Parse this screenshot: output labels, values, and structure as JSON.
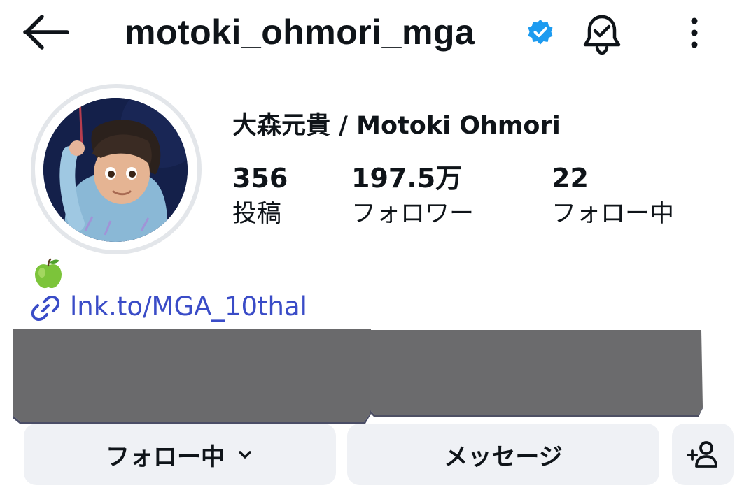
{
  "header": {
    "username": "motoki_ohmori_mga",
    "icons": {
      "back": "arrow-left-icon",
      "verified": "verified-badge-icon",
      "notifications": "bell-check-icon",
      "more": "more-vertical-icon"
    }
  },
  "profile": {
    "display_name": "大森元貴 / Motoki Ohmori",
    "stats": [
      {
        "value": "356",
        "label": "投稿"
      },
      {
        "value": "197.5万",
        "label": "フォロワー"
      },
      {
        "value": "22",
        "label": "フォロー中"
      }
    ]
  },
  "bio": {
    "emoji": "green-apple",
    "link_icon": "link-icon",
    "link": "lnk.to/MGA_10thal"
  },
  "actions": {
    "following_label": "フォロー中",
    "message_label": "メッセージ",
    "add_user_icon": "add-person-icon"
  },
  "colors": {
    "accent_link": "#3a4cc7",
    "verified": "#1d9bf0",
    "button_bg": "#eff1f5"
  }
}
